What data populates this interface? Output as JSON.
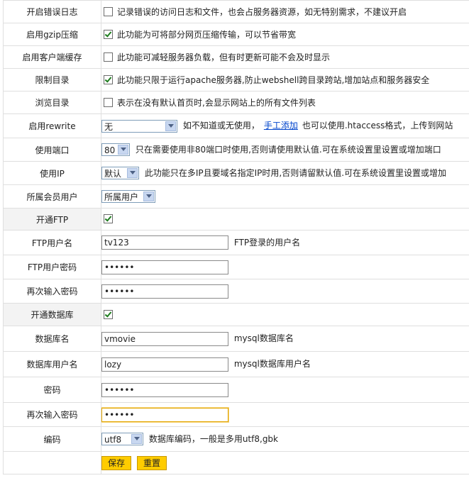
{
  "rows": {
    "error_log": {
      "label": "开启错误日志",
      "desc": "记录错误的访问日志和文件，也会占服务器资源，如无特别需求，不建议开启",
      "checked": false
    },
    "gzip": {
      "label": "启用gzip压缩",
      "desc": "此功能为可将部分网页压缩传输，可以节省带宽",
      "checked": true
    },
    "client_cache": {
      "label": "启用客户端缓存",
      "desc": "此功能可减轻服务器负载，但有时更新可能不会及时显示",
      "checked": false
    },
    "restrict_dir": {
      "label": "限制目录",
      "desc": "此功能只限于运行apache服务器,防止webshell跨目录跨站,增加站点和服务器安全",
      "checked": true
    },
    "browse_dir": {
      "label": "浏览目录",
      "desc": "表示在没有默认首页时,会显示网站上的所有文件列表",
      "checked": false
    },
    "rewrite": {
      "label": "启用rewrite",
      "selected": "无",
      "desc_before": "如不知道或无使用，",
      "link": "手工添加",
      "desc_after": "也可以使用.htaccess格式，上传到网站"
    },
    "port": {
      "label": "使用端口",
      "selected": "80",
      "desc": "只在需要使用非80端口时使用,否则请使用默认值.可在系统设置里设置或增加端口"
    },
    "ip": {
      "label": "使用IP",
      "selected": "默认",
      "desc": "此功能只在多IP且要域名指定IP时用,否则请留默认值.可在系统设置里设置或增加"
    },
    "owner": {
      "label": "所属会员用户",
      "selected": "所属用户"
    },
    "ftp_enable": {
      "label": "开通FTP",
      "checked": true
    },
    "ftp_user": {
      "label": "FTP用户名",
      "value": "tv123",
      "hint": "FTP登录的用户名"
    },
    "ftp_pass": {
      "label": "FTP用户密码",
      "value": "••••••"
    },
    "ftp_pass2": {
      "label": "再次输入密码",
      "value": "••••••"
    },
    "db_enable": {
      "label": "开通数据库",
      "checked": true
    },
    "db_name": {
      "label": "数据库名",
      "value": "vmovie",
      "hint": "mysql数据库名"
    },
    "db_user": {
      "label": "数据库用户名",
      "value": "lozy",
      "hint": "mysql数据库用户名"
    },
    "db_pass": {
      "label": "密码",
      "value": "••••••"
    },
    "db_pass2": {
      "label": "再次输入密码",
      "value": "••••••"
    },
    "encoding": {
      "label": "编码",
      "selected": "utf8",
      "desc": "数据库编码，一般是多用utf8,gbk"
    }
  },
  "buttons": {
    "save": "保存",
    "reset": "重置"
  },
  "colors": {
    "button_bg": "#ffcc00",
    "check": "#1e7d1e",
    "link": "#0044cc"
  }
}
